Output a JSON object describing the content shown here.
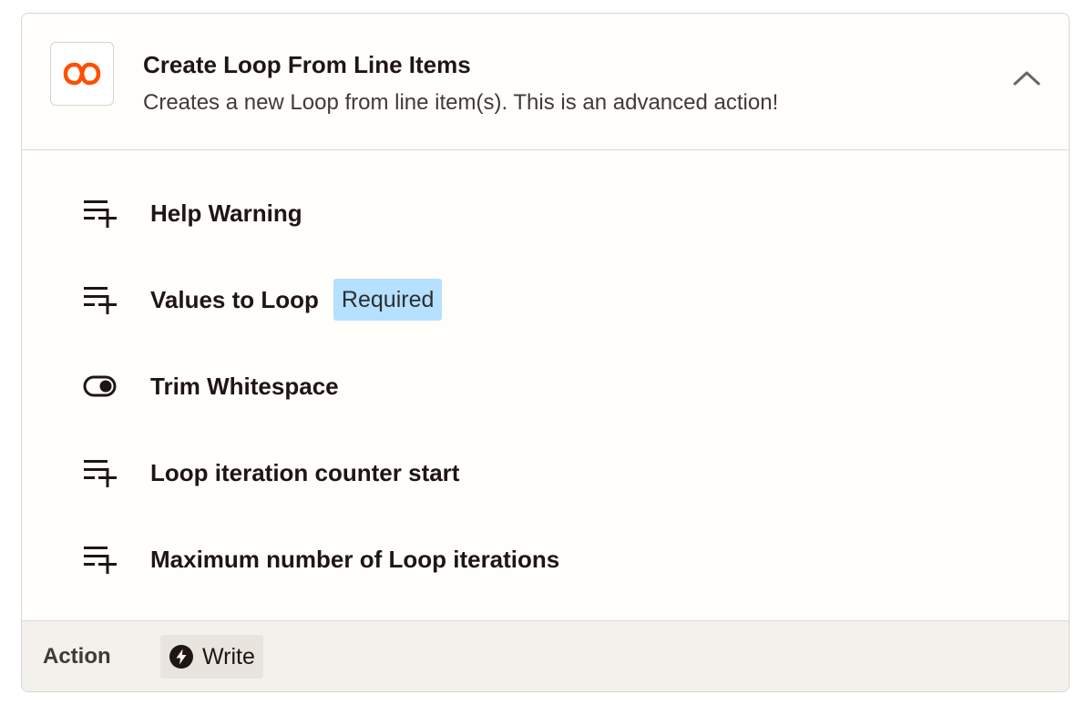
{
  "header": {
    "title": "Create Loop From Line Items",
    "description": "Creates a new Loop from line item(s). This is an advanced action!",
    "app_icon": "loop-infinity-icon",
    "collapse_icon": "chevron-up-icon"
  },
  "fields": [
    {
      "label": "Help Warning",
      "icon": "list-add-icon"
    },
    {
      "label": "Values to Loop",
      "icon": "list-add-icon",
      "badge": "Required"
    },
    {
      "label": "Trim Whitespace",
      "icon": "toggle-icon"
    },
    {
      "label": "Loop iteration counter start",
      "icon": "list-add-icon"
    },
    {
      "label": "Maximum number of Loop iterations",
      "icon": "list-add-icon"
    }
  ],
  "footer": {
    "label": "Action",
    "action_type": "Write",
    "action_icon": "bolt-icon"
  },
  "colors": {
    "brand": "#ff4f00",
    "badge_bg": "#b5e0ff",
    "footer_bg": "#f3f1ec",
    "card_bg": "#fffefb"
  }
}
